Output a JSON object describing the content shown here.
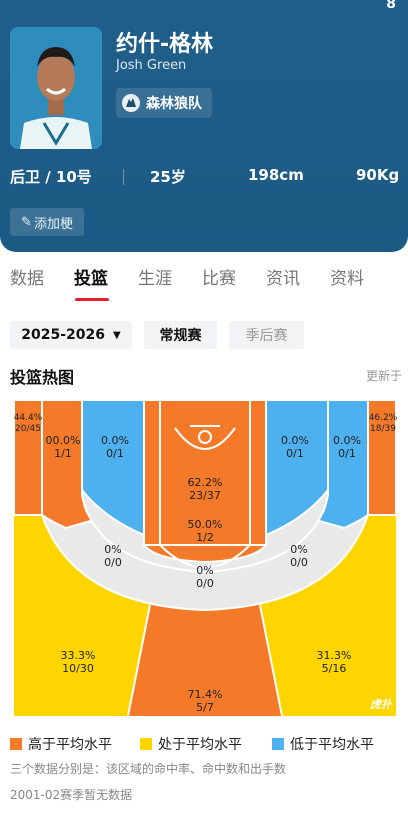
{
  "status_fragment": "8",
  "player": {
    "name_cn": "约什-格林",
    "name_en": "Josh Green",
    "team": "森林狼队",
    "position_number": "后卫 / 10号",
    "age": "25岁",
    "height": "198cm",
    "weight": "90Kg",
    "add_tag_label": "添加梗"
  },
  "tabs": [
    "数据",
    "投篮",
    "生涯",
    "比赛",
    "资讯",
    "资料"
  ],
  "active_tab": "投篮",
  "filters": {
    "season": "2025-2026",
    "regular": "常规赛",
    "playoff": "季后赛"
  },
  "section": {
    "title": "投篮热图",
    "updated": "更新于"
  },
  "zones": {
    "left_corner3": {
      "pct": "44.4%",
      "made_att": "20/45"
    },
    "right_corner3": {
      "pct": "46.2%",
      "made_att": "18/39"
    },
    "left_mid_baseline": {
      "pct": "00.0%",
      "made_att": "1/1"
    },
    "left_short_baseline": {
      "pct": "0.0%",
      "made_att": "0/1"
    },
    "paint": {
      "pct": "62.2%",
      "made_att": "23/37"
    },
    "right_short_baseline": {
      "pct": "0.0%",
      "made_att": "0/1"
    },
    "right_mid_baseline": {
      "pct": "0.0%",
      "made_att": "0/1"
    },
    "free_throw": {
      "pct": "50.0%",
      "made_att": "1/2"
    },
    "left_elbow": {
      "pct": "0%",
      "made_att": "0/0"
    },
    "right_elbow": {
      "pct": "0%",
      "made_att": "0/0"
    },
    "top_key": {
      "pct": "0%",
      "made_att": "0/0"
    },
    "left_wing3": {
      "pct": "33.3%",
      "made_att": "10/30"
    },
    "right_wing3": {
      "pct": "31.3%",
      "made_att": "5/16"
    },
    "top3": {
      "pct": "71.4%",
      "made_att": "5/7"
    }
  },
  "watermark": "虎扑",
  "legend": {
    "above": "高于平均水平",
    "avg": "处于平均水平",
    "below": "低于平均水平"
  },
  "colors": {
    "above": "#f47a2a",
    "avg": "#ffd500",
    "below": "#4db0ef",
    "neutral": "#e9e9e9",
    "header": "#1d5c86",
    "accent": "#e8202a"
  },
  "notes": {
    "explain": "三个数据分别是：该区域的命中率、命中数和出手数",
    "no_data": "2001-02赛季暂无数据"
  }
}
